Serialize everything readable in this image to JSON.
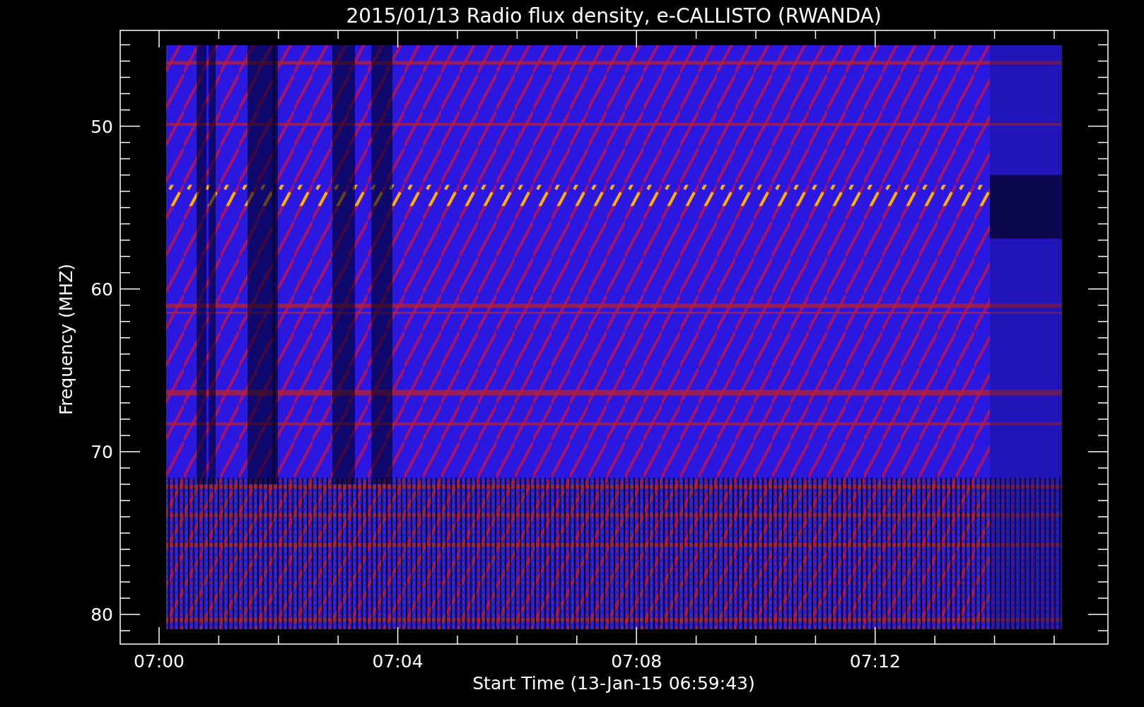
{
  "chart": {
    "title": "2015/01/13  Radio flux density, e-CALLISTO (RWANDA)",
    "xlabel": "Start Time (13-Jan-15 06:59:43)",
    "ylabel": "Frequency (MHZ)",
    "xticks": [
      "07:00",
      "07:04",
      "07:08",
      "07:12"
    ],
    "yticks": [
      "50",
      "60",
      "70",
      "80"
    ]
  }
}
